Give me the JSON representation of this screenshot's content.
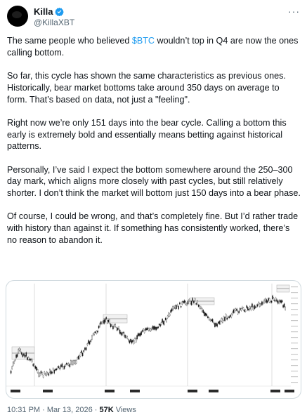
{
  "author": {
    "name": "Killa",
    "handle": "@KillaXBT"
  },
  "tweet": {
    "p1_a": "The same people who believed ",
    "cashtag": "$BTC",
    "p1_b": " wouldn’t top in Q4 are now the ones calling bottom.",
    "p2": "So far, this cycle has shown the same characteristics as previous ones. Historically, bear market bottoms take around 350 days on average to form. That’s based on data, not just a \"feeling\".",
    "p3": "Right now we’re only 151 days into the bear cycle. Calling a bottom this early is extremely bold and essentially means betting against historical patterns.",
    "p4": "Personally, I’ve said I expect the bottom somewhere around the 250–300 day mark, which aligns more closely with past cycles, but still relatively shorter. I don’t think the market will bottom just 150 days into a bear phase.",
    "p5": "Of course, I could be wrong, and that’s completely fine. But I’d rather trade with history than against it. If something has consistently worked, there’s no reason to abandon it."
  },
  "meta": {
    "time": "10:31 PM",
    "sep": " · ",
    "date": "Mar 13, 2026",
    "views_count": "57K",
    "views_label": " Views"
  },
  "colors": {
    "accent": "#1d9bf0",
    "muted": "#536471",
    "up": "#ffffff",
    "down": "#111111"
  },
  "icons": {
    "verified": "verified-badge-icon",
    "more": "more-options-icon"
  }
}
